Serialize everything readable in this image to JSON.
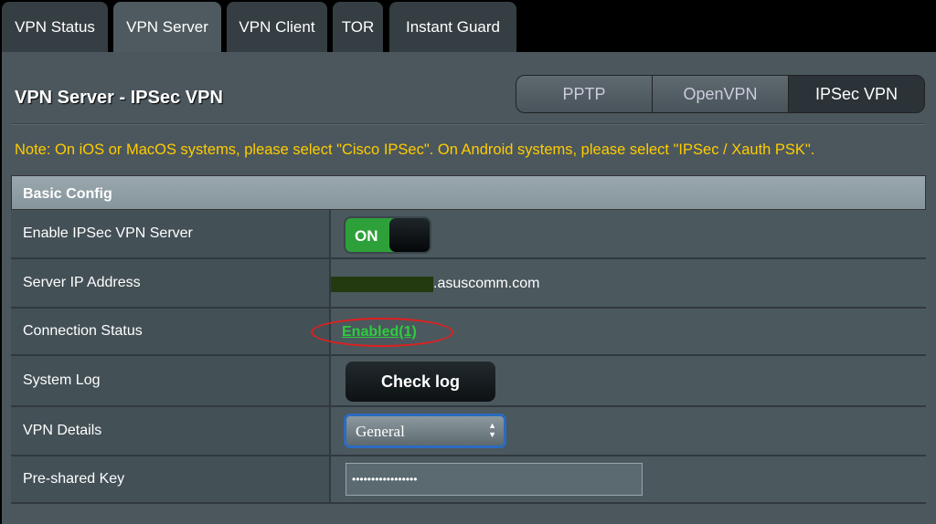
{
  "tabs": [
    "VPN Status",
    "VPN Server",
    "VPN Client",
    "TOR",
    "Instant Guard"
  ],
  "title": "VPN Server - IPSec VPN",
  "protocols": [
    "PPTP",
    "OpenVPN",
    "IPSec VPN"
  ],
  "note": "Note: On iOS or MacOS systems, please select \"Cisco IPSec\". On Android systems, please select \"IPSec / Xauth PSK\".",
  "section": "Basic Config",
  "rows": {
    "enable": {
      "label": "Enable IPSec VPN Server",
      "toggle": "ON"
    },
    "server_ip": {
      "label": "Server IP Address",
      "value": ".asuscomm.com"
    },
    "status": {
      "label": "Connection Status",
      "value": "Enabled(1)"
    },
    "log": {
      "label": "System Log",
      "button": "Check log"
    },
    "details": {
      "label": "VPN Details",
      "value": "General"
    },
    "psk": {
      "label": "Pre-shared Key",
      "value": "•••••••••••••••••"
    }
  },
  "colors": {
    "note": "#ffcc00",
    "enabled": "#2ecc40",
    "toggle_on": "#2ea03a",
    "highlight_ellipse": "#e0201e"
  }
}
